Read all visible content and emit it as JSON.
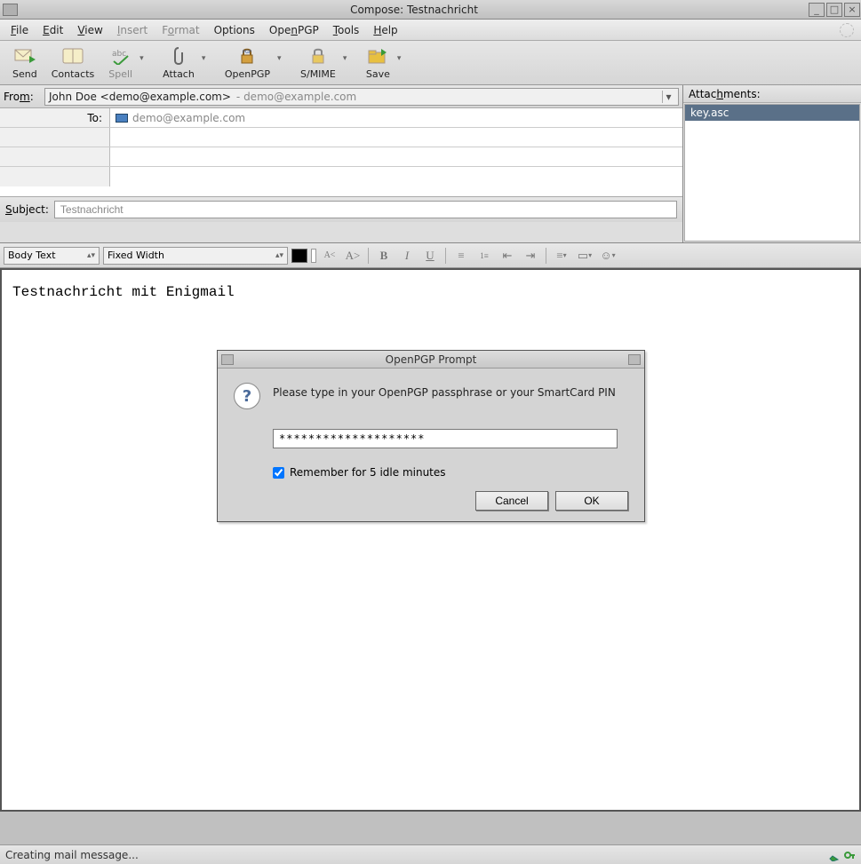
{
  "window": {
    "title": "Compose: Testnachricht"
  },
  "menu": {
    "file": "File",
    "edit": "Edit",
    "view": "View",
    "insert": "Insert",
    "format": "Format",
    "options": "Options",
    "openpgp": "OpenPGP",
    "tools": "Tools",
    "help": "Help"
  },
  "toolbar": {
    "send": "Send",
    "contacts": "Contacts",
    "spell": "Spell",
    "attach": "Attach",
    "openpgp": "OpenPGP",
    "smime": "S/MIME",
    "save": "Save"
  },
  "from": {
    "label": "From:",
    "identity": "John Doe <demo@example.com>",
    "account": "- demo@example.com"
  },
  "to": {
    "label": "To:",
    "value": "demo@example.com"
  },
  "subject": {
    "label": "Subject:",
    "value": "Testnachricht"
  },
  "attachments": {
    "label": "Attachments:",
    "items": [
      "key.asc"
    ]
  },
  "format": {
    "para": "Body Text",
    "font": "Fixed Width"
  },
  "body": {
    "text": "Testnachricht mit Enigmail"
  },
  "dialog": {
    "title": "OpenPGP Prompt",
    "message": "Please type in your OpenPGP passphrase or your SmartCard PIN",
    "input_value": "********************",
    "remember": "Remember for 5 idle minutes",
    "cancel": "Cancel",
    "ok": "OK"
  },
  "status": {
    "text": "Creating mail message..."
  }
}
